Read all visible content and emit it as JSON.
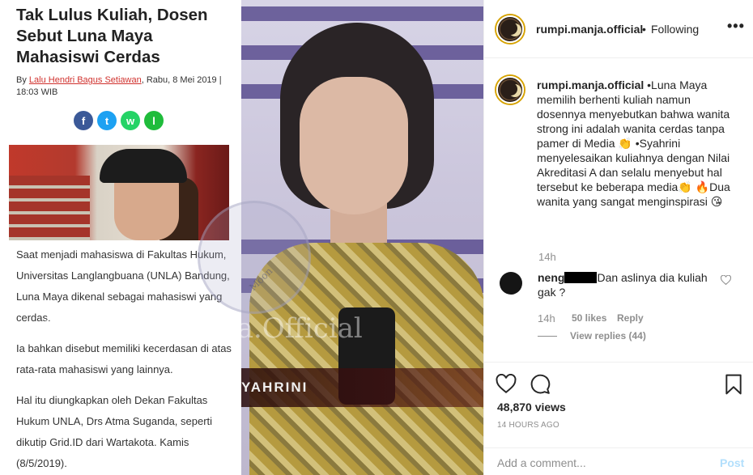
{
  "article": {
    "title": "Tak Lulus Kuliah, Dosen Sebut Luna Maya Mahasiswi Cerdas",
    "by_prefix": "By ",
    "author": "Lalu Hendri Bagus Setiawan",
    "date": ", Rabu, 8 Mei 2019 | 18:03 WIB",
    "share_buttons": [
      "f",
      "t",
      "w",
      "l"
    ],
    "paragraphs": [
      "Saat menjadi mahasiswa di Fakultas Hukum, Universitas Langlangbuana (UNLA) Bandung, Luna Maya dikenal sebagai mahasiswi yang cerdas.",
      "Ia bahkan disebut memiliki kecerdasan di atas rata-rata mahasiswi yang lainnya.",
      "Hal itu diungkapkan oleh Dekan Fakultas Hukum UNLA, Drs Atma Suganda, seperti dikutip Grid.ID dari Wartakota. Kamis (8/5/2019)."
    ]
  },
  "video": {
    "name_tag": "YAHRINI",
    "watermark": "@Rumpi.Manja.Official",
    "watermark_logo_text": "Moon"
  },
  "header": {
    "username": "rumpi.manja.official",
    "separator": "•",
    "follow_status": "Following",
    "more": "•••"
  },
  "caption": {
    "username": "rumpi.manja.official",
    "text": " •Luna Maya memilih berhenti kuliah namun dosennya menyebutkan bahwa wanita strong ini adalah wanita cerdas tanpa pamer di Media 👏 •Syahrini menyelesaikan kuliahnya dengan Nilai Akreditasi A dan selalu menyebut hal tersebut ke beberapa media👏 🔥Dua wanita yang sangat menginspirasi 😘",
    "time": "14h"
  },
  "comment": {
    "username": "neng",
    "text": "Dan aslinya dia kuliah gak ?",
    "time": "14h",
    "likes": "50 likes",
    "reply": "Reply",
    "view_replies": "View replies (44)"
  },
  "actions": {
    "views": "48,870 views",
    "posted_ago": "14 HOURS AGO"
  },
  "add_comment": {
    "placeholder": "Add a comment...",
    "post_label": "Post"
  },
  "colors": {
    "follow_ring": "#d6a200",
    "post_disabled": "#b2dffc",
    "author_link": "#d0312d"
  },
  "icons": [
    "heart-icon",
    "comment-icon",
    "bookmark-icon",
    "more-icon"
  ]
}
